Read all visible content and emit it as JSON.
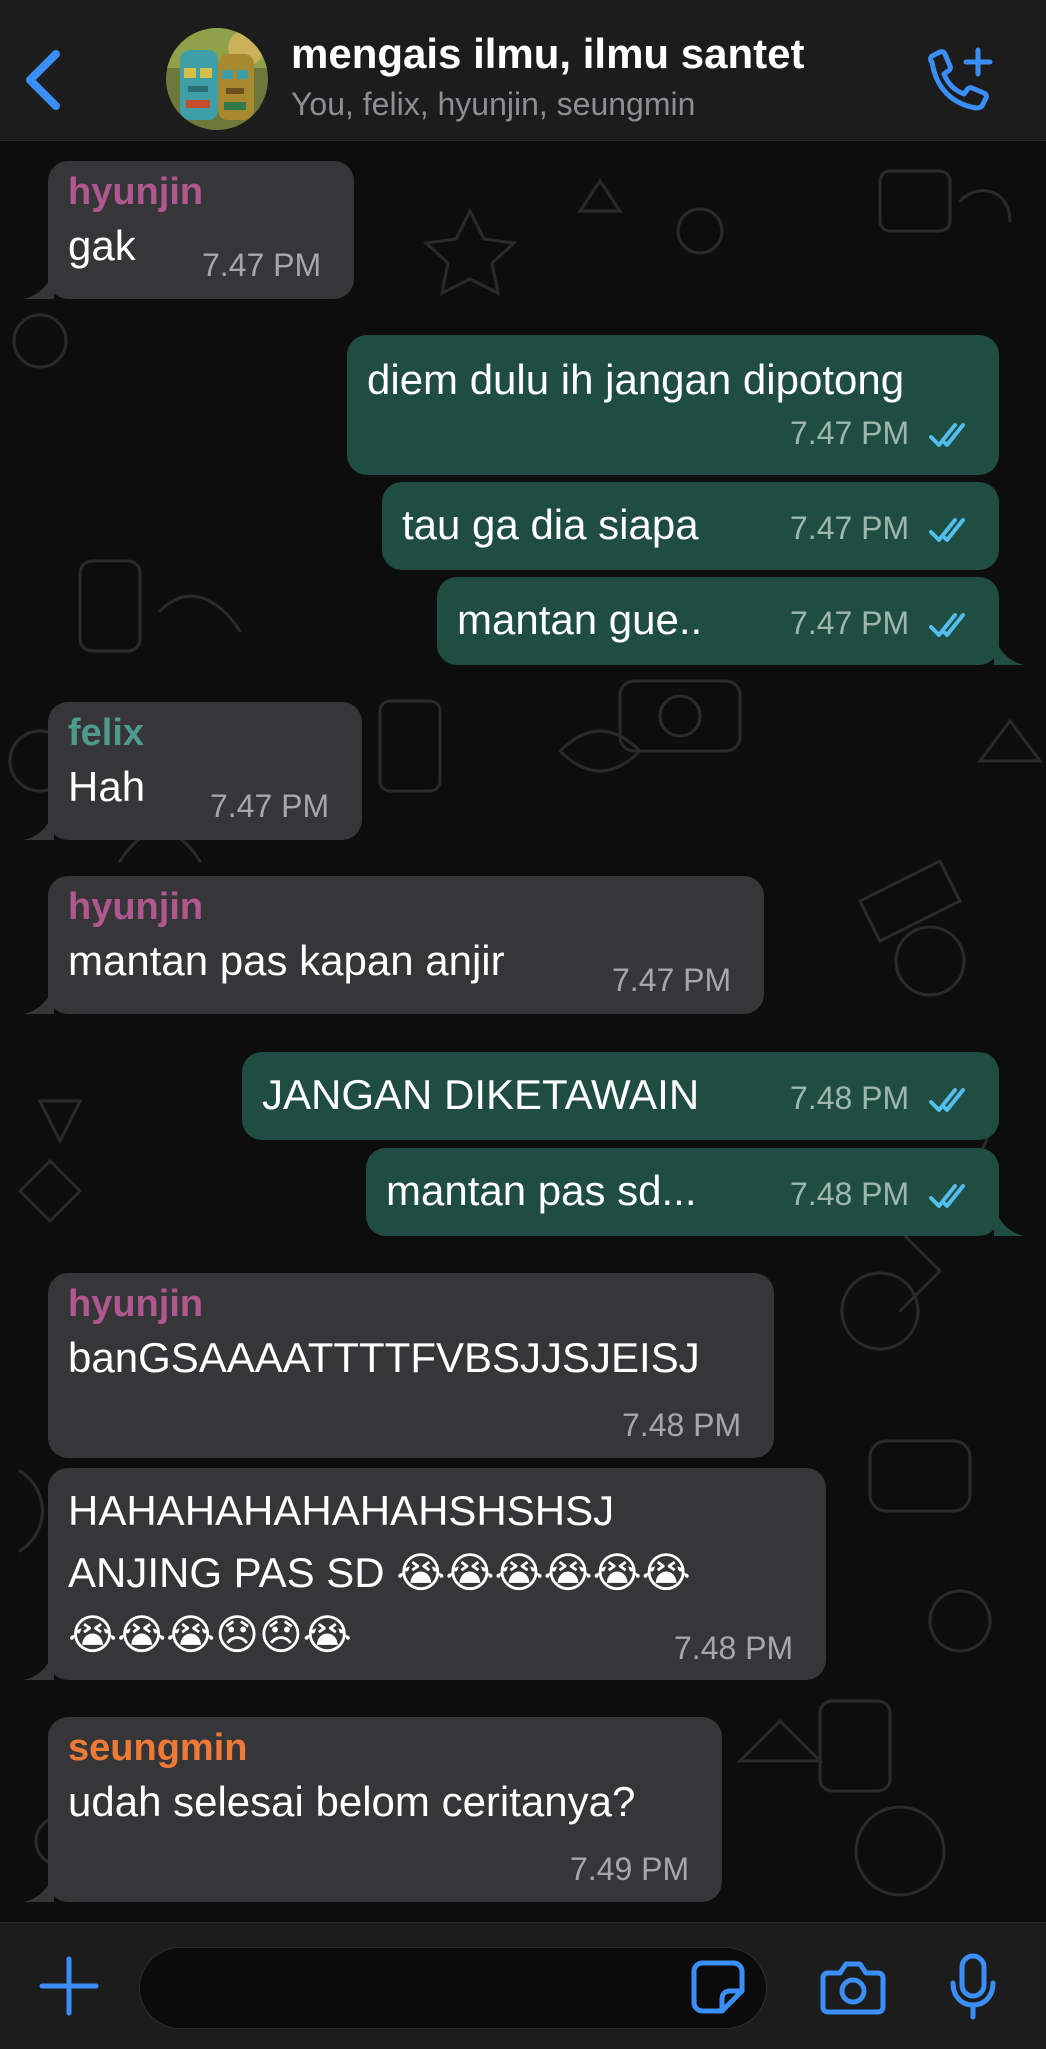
{
  "header": {
    "back_label": "",
    "title": "mengais ilmu, ilmu santet",
    "members": "You, felix, hyunjin, seungmin"
  },
  "colors": {
    "accent": "#3a8ef6",
    "incoming_bubble": "#363638",
    "outgoing_bubble": "#1f4d41",
    "sender_hyunjin": "#b0578f",
    "sender_felix": "#4f9a8f",
    "sender_seungmin": "#ef7a36",
    "read_ticks": "#53bdeb"
  },
  "messages": [
    {
      "dir": "in",
      "sender": "hyunjin",
      "text": "gak",
      "time": "7.47 PM"
    },
    {
      "dir": "out",
      "text": "diem dulu ih jangan dipotong",
      "time": "7.47 PM",
      "status": "read"
    },
    {
      "dir": "out",
      "text": "tau ga dia siapa",
      "time": "7.47 PM",
      "status": "read"
    },
    {
      "dir": "out",
      "text": "mantan gue..",
      "time": "7.47 PM",
      "status": "read"
    },
    {
      "dir": "in",
      "sender": "felix",
      "text": "Hah",
      "time": "7.47 PM"
    },
    {
      "dir": "in",
      "sender": "hyunjin",
      "text": "mantan pas kapan anjir",
      "time": "7.47 PM"
    },
    {
      "dir": "out",
      "text": "JANGAN DIKETAWAIN",
      "time": "7.48 PM",
      "status": "read"
    },
    {
      "dir": "out",
      "text": "mantan pas sd...",
      "time": "7.48 PM",
      "status": "read"
    },
    {
      "dir": "in",
      "sender": "hyunjin",
      "text": "banGSAAAATTTTFVBSJJSJEISJ",
      "time": "7.48 PM"
    },
    {
      "dir": "in",
      "text_lines": [
        "HAHAHAHAHAHAHSHSHSJ",
        "ANJING PAS SD 😭😭😭😭😭😭",
        "😭😭😭😞😞😭"
      ],
      "time": "7.48 PM"
    },
    {
      "dir": "in",
      "sender": "seungmin",
      "text": "udah selesai belom ceritanya?",
      "time": "7.49 PM"
    }
  ],
  "composer": {
    "placeholder": "",
    "icons": [
      "plus-icon",
      "sticker-icon",
      "camera-icon",
      "microphone-icon"
    ]
  }
}
